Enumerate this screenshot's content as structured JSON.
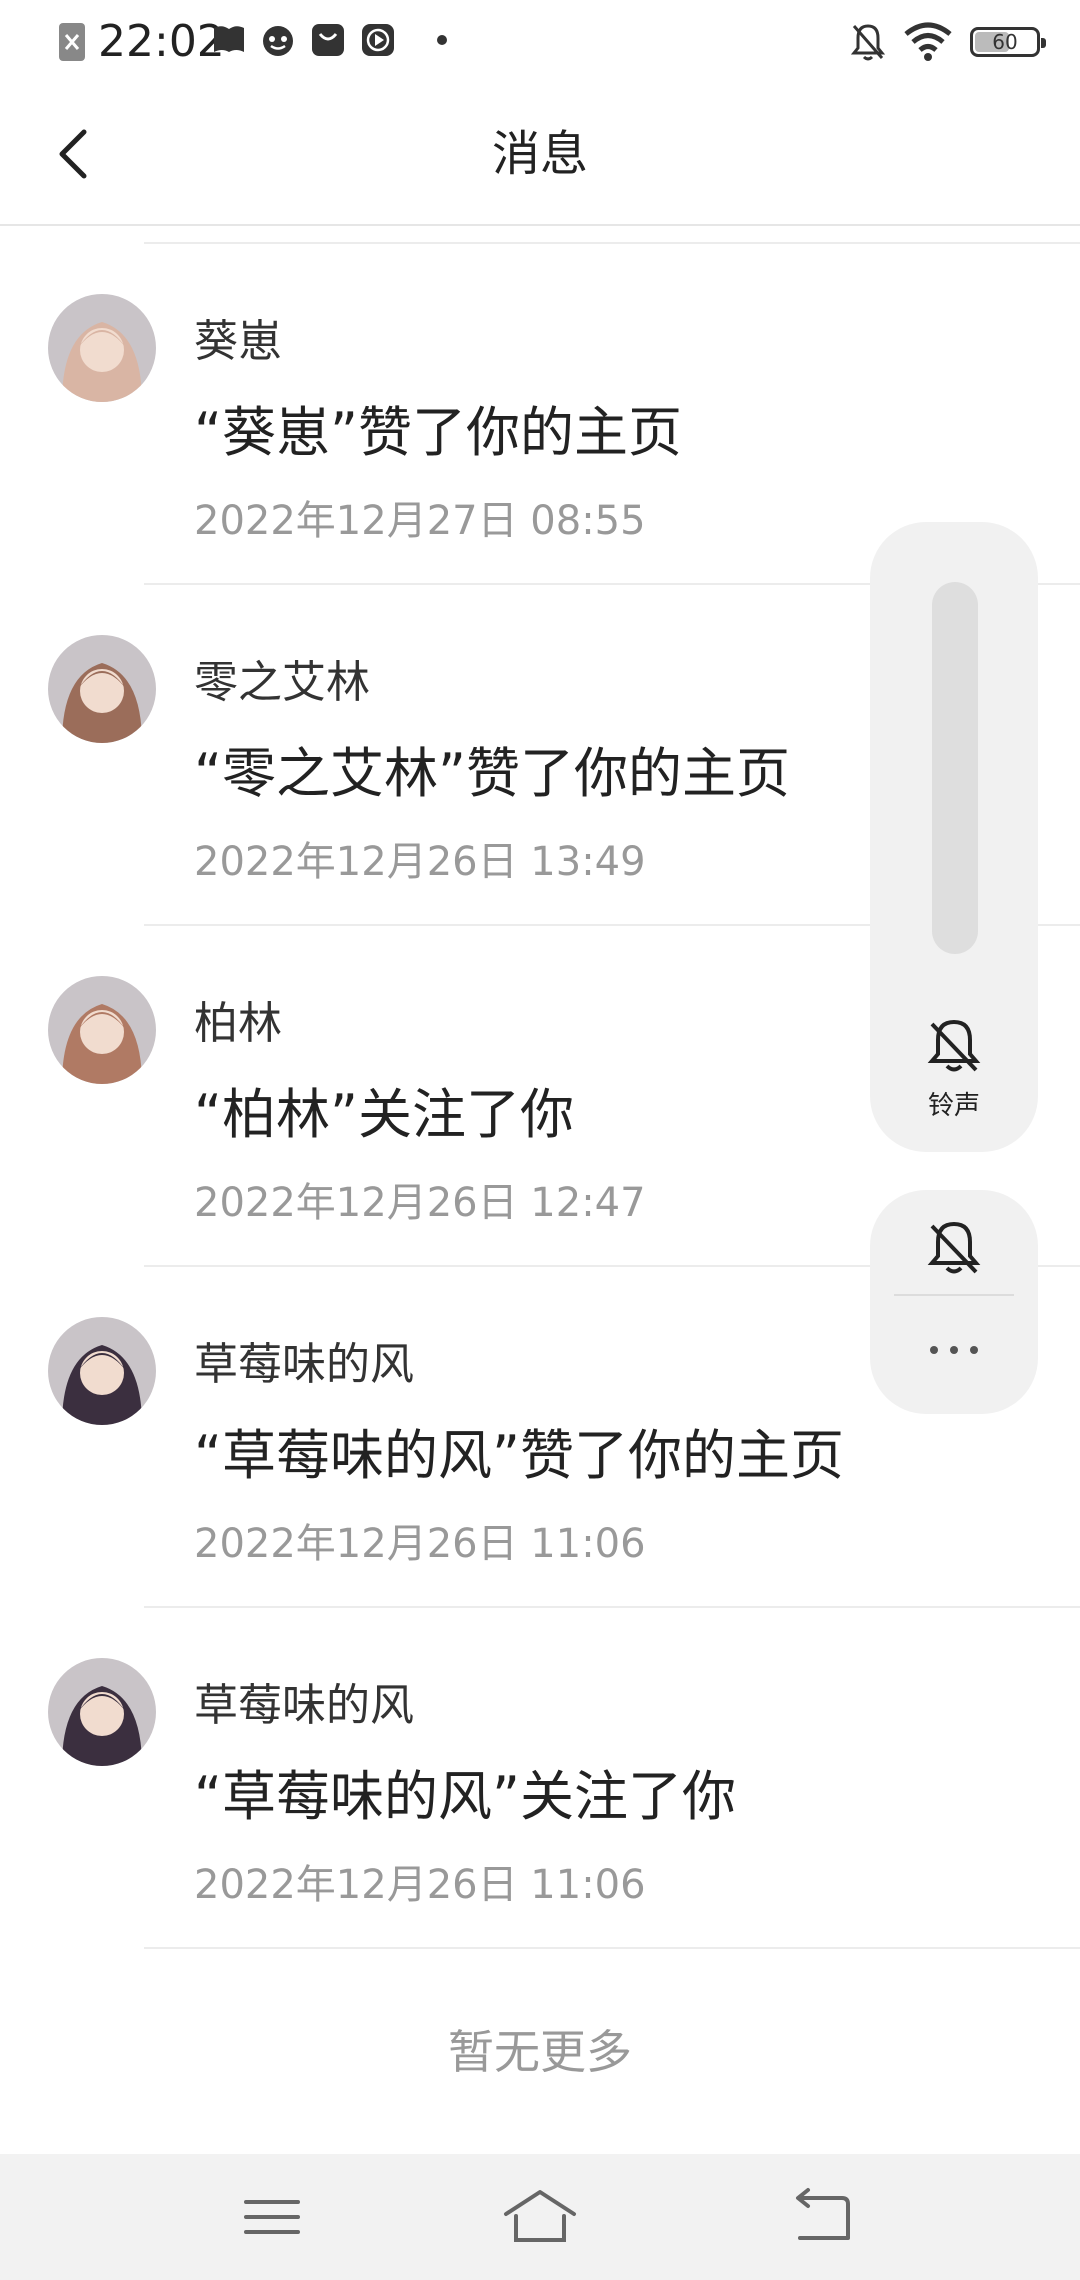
{
  "status_bar": {
    "time": "22:02",
    "left_icons": [
      "x-close-icon",
      "book-icon",
      "face-app-icon",
      "bag-icon",
      "play-icon",
      "dot-icon"
    ],
    "right_icons": [
      "mute-bell-icon",
      "wifi-icon",
      "battery-icon"
    ],
    "battery_level": "60"
  },
  "header": {
    "title": "消息"
  },
  "messages": [
    {
      "name": "葵崽",
      "text": "“葵崽”赞了你的主页",
      "time": "2022年12月27日 08:55",
      "avatar_color": "#d9b5a4"
    },
    {
      "name": "零之艾林",
      "text": "“零之艾林”赞了你的主页",
      "time": "2022年12月26日 13:49",
      "avatar_color": "#9b6d5a"
    },
    {
      "name": "柏林",
      "text": "“柏林”关注了你",
      "time": "2022年12月26日 12:47",
      "avatar_color": "#b07a64"
    },
    {
      "name": "草莓味的风",
      "text": "“草莓味的风”赞了你的主页",
      "time": "2022年12月26日 11:06",
      "avatar_color": "#3b2f3f"
    },
    {
      "name": "草莓味的风",
      "text": "“草莓味的风”关注了你",
      "time": "2022年12月26日 11:06",
      "avatar_color": "#3b2f3f"
    }
  ],
  "footer": {
    "no_more": "暂无更多"
  },
  "volume_panel": {
    "ringtone_label": "铃声",
    "level": 0
  },
  "nav_bar": {
    "icons": [
      "menu-icon",
      "home-icon",
      "back-nav-icon"
    ]
  }
}
